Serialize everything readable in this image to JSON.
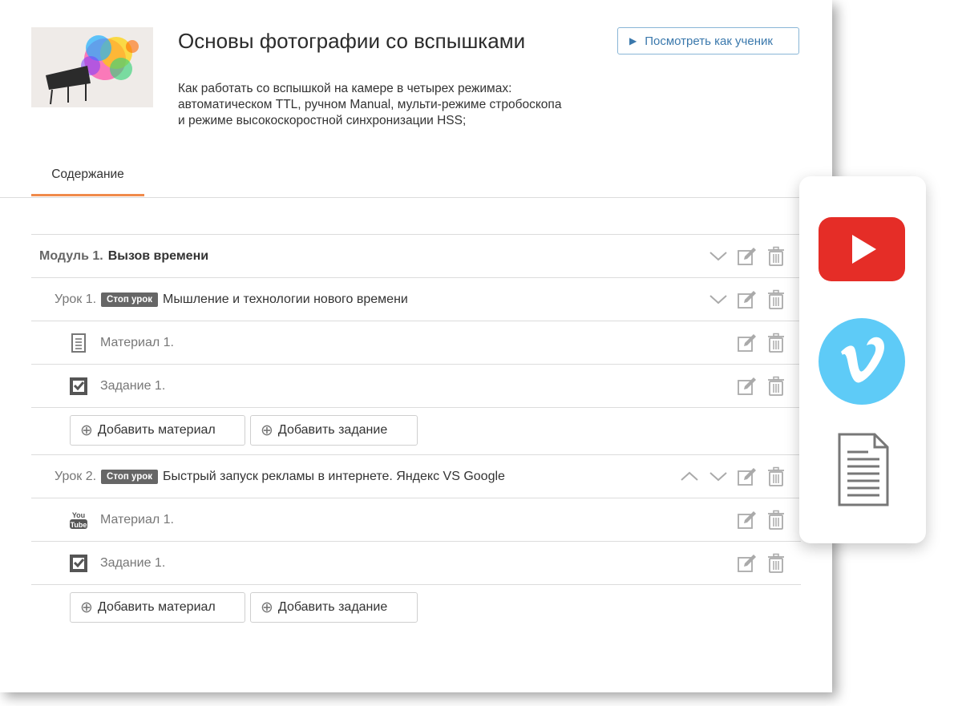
{
  "course": {
    "title": "Основы фотографии со вспышками",
    "description_lines": [
      "Как работать со вспышкой на камере в четырех режимах:",
      "автоматическом TTL, ручном Manual, мульти-режиме стробоскопа",
      "и режиме высокоскоростной синхронизации HSS;"
    ],
    "preview_button_label": "Посмотреть как ученик"
  },
  "tabs": [
    {
      "label": "Содержание",
      "active": true
    }
  ],
  "module": {
    "prefix": "Модуль 1.",
    "name": "Вызов времени"
  },
  "lessons": [
    {
      "prefix": "Урок 1.",
      "badge": "Стоп урок",
      "name": "Мышление и технологии нового времени",
      "items": [
        {
          "icon": "document-icon",
          "label": "Материал 1."
        },
        {
          "icon": "task-checkbox-icon",
          "label": "Задание 1."
        }
      ],
      "add_material_label": "Добавить материал",
      "add_task_label": "Добавить задание"
    },
    {
      "prefix": "Урок 2.",
      "badge": "Стоп урок",
      "name": "Быстрый запуск рекламы в интернете. Яндекс VS Google",
      "items": [
        {
          "icon": "youtube-small-icon",
          "label": "Материал 1."
        },
        {
          "icon": "task-checkbox-icon",
          "label": "Задание 1."
        }
      ],
      "add_material_label": "Добавить материал",
      "add_task_label": "Добавить задание"
    }
  ],
  "side_panel": {
    "icons": [
      "youtube-icon",
      "vimeo-icon",
      "document-icon"
    ]
  },
  "colors": {
    "accent": "#f08a4b",
    "link": "#3a78ac",
    "youtube": "#e52d27",
    "vimeo": "#5ecbf7",
    "badge": "#666666"
  }
}
